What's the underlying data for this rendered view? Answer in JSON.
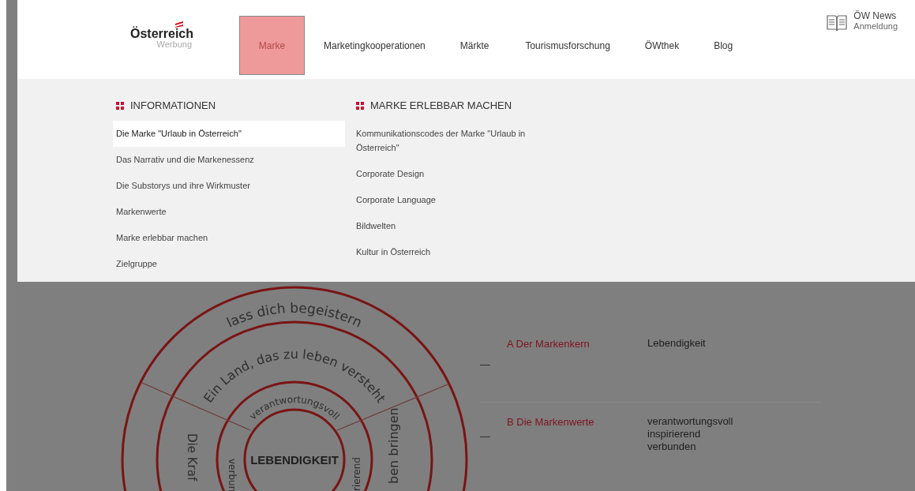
{
  "logo": {
    "name": "Österreich",
    "subtitle": "Werbung"
  },
  "nav": [
    {
      "label": "Marke",
      "selected": true
    },
    {
      "label": "Marketingkooperationen",
      "selected": false
    },
    {
      "label": "Märkte",
      "selected": false
    },
    {
      "label": "Tourismusforschung",
      "selected": false
    },
    {
      "label": "ÖWthek",
      "selected": false
    },
    {
      "label": "Blog",
      "selected": false
    }
  ],
  "news": {
    "title": "ÖW News",
    "subtitle": "Anmeldung"
  },
  "mega_menu": [
    {
      "heading": "INFORMATIONEN",
      "items": [
        {
          "label": "Die Marke \"Urlaub in Österreich\"",
          "selected": true
        },
        {
          "label": "Das Narrativ und die Markenessenz",
          "selected": false
        },
        {
          "label": "Die Substorys und ihre Wirkmuster",
          "selected": false
        },
        {
          "label": "Markenwerte",
          "selected": false
        },
        {
          "label": "Marke erlebbar machen",
          "selected": false
        },
        {
          "label": "Zielgruppe",
          "selected": false
        }
      ]
    },
    {
      "heading": "MARKE ERLEBBAR MACHEN",
      "items": [
        {
          "label": "Kommunikationscodes der Marke \"Urlaub in Österreich\"",
          "selected": false
        },
        {
          "label": "Corporate Design",
          "selected": false
        },
        {
          "label": "Corporate Language",
          "selected": false
        },
        {
          "label": "Bildwelten",
          "selected": false
        },
        {
          "label": "Kultur in Österreich",
          "selected": false
        }
      ]
    }
  ],
  "diagram": {
    "center": "LEBENDIGKEIT",
    "labels": [
      "lass dich begeistern",
      "Ein Land, das zu leben versteht",
      "verantwortungsvoll",
      "Die Kraf",
      "verbun",
      "rierend",
      "ben bringen"
    ]
  },
  "brand_rows": [
    {
      "marker": "—",
      "title": "A Der Markenkern",
      "values": [
        "Lebendigkeit"
      ]
    },
    {
      "marker": "—",
      "title": "B Die Markenwerte",
      "values": [
        "verantwortungsvoll",
        "inspirierend",
        "verbunden"
      ]
    }
  ]
}
